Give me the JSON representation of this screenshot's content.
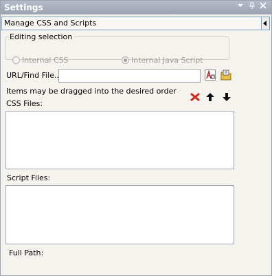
{
  "window": {
    "title": "Settings",
    "pin_icon": "pin-icon",
    "close_icon": "close-icon",
    "menu_icon": "chevron-down-icon"
  },
  "section": {
    "selected": "Manage CSS and Scripts"
  },
  "editing": {
    "legend": "Editing selection",
    "options": [
      {
        "label": "Internal CSS",
        "checked": false,
        "enabled": false
      },
      {
        "label": "Internal Java Script",
        "checked": true,
        "enabled": false
      }
    ]
  },
  "url": {
    "label": "URL/Find File...",
    "value": ""
  },
  "hint": "Items may be dragged into the desired order",
  "css": {
    "label": "CSS Files:",
    "items": []
  },
  "scripts": {
    "label": "Script Files:",
    "items": []
  },
  "full_path": {
    "label": "Full Path:",
    "value": ""
  },
  "colors": {
    "titlebar": "#a8aebd",
    "delete": "#d0281c"
  }
}
